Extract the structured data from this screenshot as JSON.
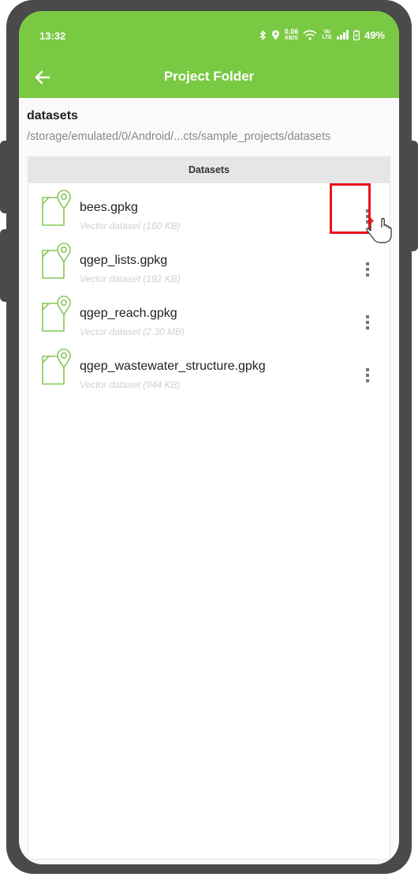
{
  "status_bar": {
    "time": "13:32",
    "net_speed_value": "0.06",
    "net_speed_unit": "KB/S",
    "volte_top": "Vo",
    "volte_bottom": "LTE",
    "battery": "49%",
    "icons": [
      "bluetooth-icon",
      "location-icon",
      "wifi-icon",
      "signal-icon",
      "battery-icon"
    ]
  },
  "app_bar": {
    "title": "Project Folder",
    "back_icon": "arrow-left-icon",
    "color": "#7ac943"
  },
  "folder": {
    "name": "datasets",
    "path": "/storage/emulated/0/Android/...cts/sample_projects/datasets"
  },
  "list": {
    "header": "Datasets",
    "items": [
      {
        "name": "bees.gpkg",
        "desc": "Vector dataset (160 KB)"
      },
      {
        "name": "qgep_lists.gpkg",
        "desc": "Vector dataset (192 KB)"
      },
      {
        "name": "qgep_reach.gpkg",
        "desc": "Vector dataset (2.30 MB)"
      },
      {
        "name": "qgep_wastewater_structure.gpkg",
        "desc": "Vector dataset (944 KB)"
      }
    ]
  },
  "annotation": {
    "highlight_color": "#e8121a",
    "pointer": "hand-pointer-icon"
  }
}
